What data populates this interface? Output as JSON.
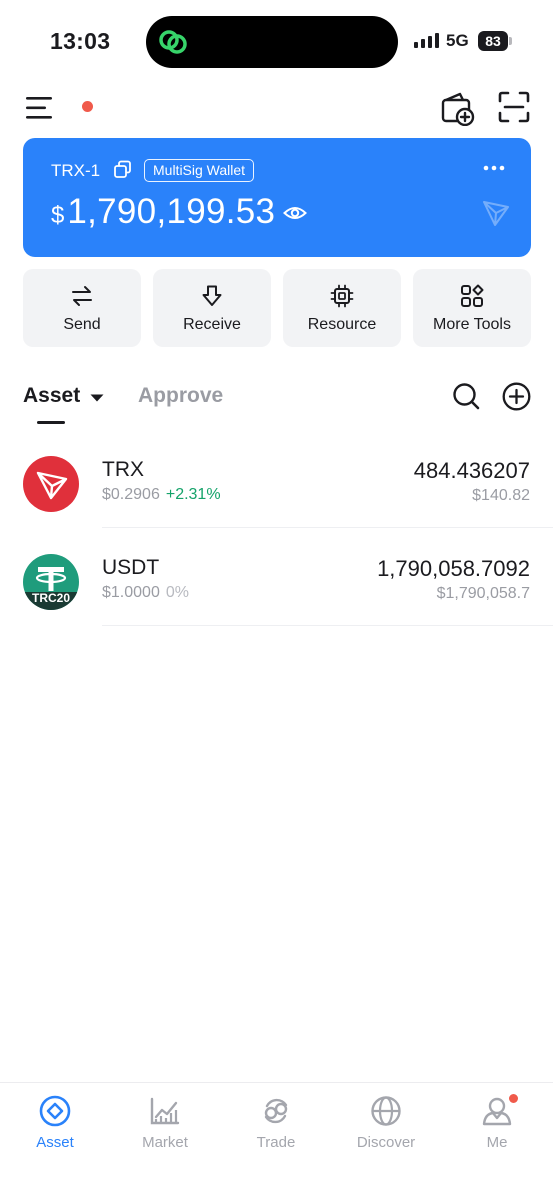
{
  "status_bar": {
    "time": "13:03",
    "network": "5G",
    "battery": "83"
  },
  "wallet": {
    "name": "TRX-1",
    "badge": "MultiSig Wallet",
    "currency_symbol": "$",
    "balance": "1,790,199.53",
    "card_color": "#2a82fa"
  },
  "actions": [
    {
      "label": "Send",
      "icon": "swap-arrows-icon"
    },
    {
      "label": "Receive",
      "icon": "download-arrow-icon"
    },
    {
      "label": "Resource",
      "icon": "chip-icon"
    },
    {
      "label": "More Tools",
      "icon": "grid-tools-icon"
    }
  ],
  "tabs": {
    "asset": "Asset",
    "approve": "Approve"
  },
  "tokens": [
    {
      "symbol": "TRX",
      "price": "$0.2906",
      "change": "+2.31%",
      "change_color": "#15a36a",
      "balance": "484.436207",
      "value": "$140.82",
      "icon": "tron-logo-icon"
    },
    {
      "symbol": "USDT",
      "price": "$1.0000",
      "change": "0%",
      "change_color": "#b8bac0",
      "balance": "1,790,058.7092",
      "value": "$1,790,058.7",
      "icon": "tether-trc20-logo-icon",
      "logo_label": "TRC20"
    }
  ],
  "bottom_nav": [
    {
      "label": "Asset",
      "icon": "asset-icon",
      "active": true
    },
    {
      "label": "Market",
      "icon": "market-chart-icon",
      "active": false
    },
    {
      "label": "Trade",
      "icon": "trade-icon",
      "active": false
    },
    {
      "label": "Discover",
      "icon": "globe-icon",
      "active": false
    },
    {
      "label": "Me",
      "icon": "user-icon",
      "active": false
    }
  ],
  "colors": {
    "accent": "#2a82fa",
    "positive": "#15a36a",
    "notification": "#f05a4b"
  }
}
